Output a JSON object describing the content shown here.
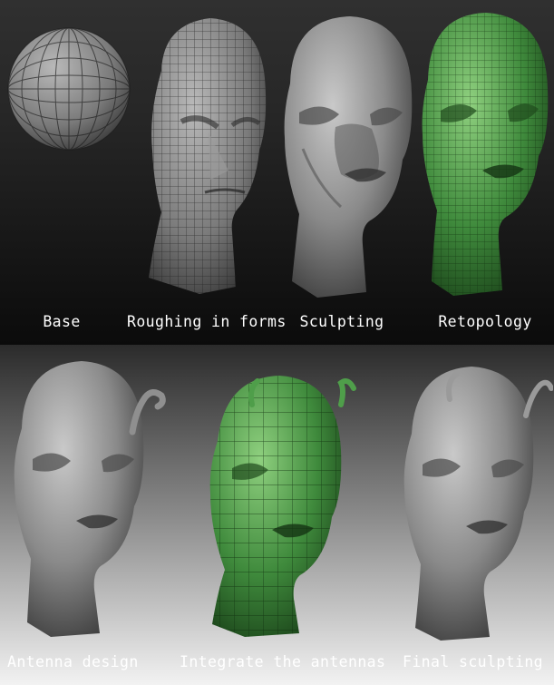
{
  "top_row": {
    "stages": [
      {
        "label": "Base",
        "icon": "sphere-mesh"
      },
      {
        "label": "Roughing in forms",
        "icon": "rough-head-mesh"
      },
      {
        "label": "Sculpting",
        "icon": "sculpted-alien-head"
      },
      {
        "label": "Retopology",
        "icon": "green-retopology-head"
      }
    ]
  },
  "bottom_row": {
    "stages": [
      {
        "label": "Antenna design",
        "icon": "alien-head-with-antenna"
      },
      {
        "label": "Integrate the antennas",
        "icon": "green-mesh-head-with-antennas"
      },
      {
        "label": "Final sculpting",
        "icon": "final-alien-head"
      }
    ]
  },
  "colors": {
    "clay": "#8c8c8c",
    "retopo_green": "#3f8a3c",
    "label": "#ffffff"
  }
}
